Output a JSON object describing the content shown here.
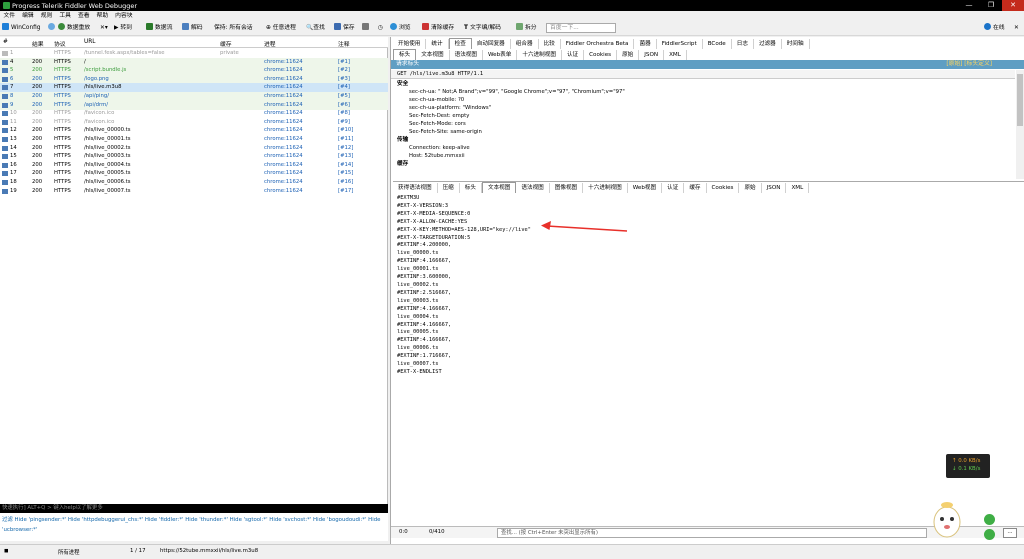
{
  "window": {
    "title": "Progress Telerik Fiddler Web Debugger",
    "controls": [
      "—",
      "❐",
      "✕"
    ]
  },
  "menu": [
    "文件",
    "编辑",
    "规则",
    "工具",
    "查看",
    "帮助",
    "内容块"
  ],
  "toolbar": [
    {
      "label": "WinConfig",
      "icon": "windows-icon"
    },
    {
      "label": "",
      "icon": "comment-icon"
    },
    {
      "label": "数据重放",
      "icon": "replay-icon"
    },
    {
      "label": "",
      "icon": "remove-icon"
    },
    {
      "label": "转到",
      "icon": "play-icon"
    },
    {
      "label": "数据流",
      "icon": "stream-icon"
    },
    {
      "label": "解码",
      "icon": "decode-icon"
    },
    {
      "label": "保持: 所有会话",
      "icon": ""
    },
    {
      "label": "任意进程",
      "icon": "crosshair-icon"
    },
    {
      "label": "查找",
      "icon": "find-icon"
    },
    {
      "label": "保存",
      "icon": "save-icon"
    },
    {
      "label": "",
      "icon": "camera-icon"
    },
    {
      "label": "",
      "icon": "clock-icon"
    },
    {
      "label": "浏览",
      "icon": "browse-icon"
    },
    {
      "label": "清除缓存",
      "icon": "clear-cache-icon"
    },
    {
      "label": "文字编/解码",
      "icon": "text-wizard-icon"
    },
    {
      "label": "拆分",
      "icon": "tearoff-icon"
    }
  ],
  "toolbar_search": "百度一下...",
  "online_label": "在线",
  "sessions": {
    "columns": [
      "#",
      "结果",
      "协议",
      "URL",
      "缓存",
      "进程",
      "注释"
    ],
    "rows": [
      {
        "id": "1",
        "result": "",
        "protocol": "HTTPS",
        "url": "/tunnel.fesk.aspx/tables=false",
        "cache": "private",
        "process": "",
        "comment": ""
      },
      {
        "id": "4",
        "result": "200",
        "protocol": "HTTPS",
        "url": "/",
        "cache": "",
        "process": "chrome:11624",
        "comment": "[#1]"
      },
      {
        "id": "5",
        "result": "200",
        "protocol": "HTTPS",
        "url": "/script.bundle.js",
        "cache": "",
        "process": "chrome:11624",
        "comment": "[#2]"
      },
      {
        "id": "6",
        "result": "200",
        "protocol": "HTTPS",
        "url": "/logo.png",
        "cache": "",
        "process": "chrome:11624",
        "comment": "[#3]"
      },
      {
        "id": "7",
        "result": "200",
        "protocol": "HTTPS",
        "url": "/hls/live.m3u8",
        "cache": "",
        "process": "chrome:11624",
        "comment": "[#4]"
      },
      {
        "id": "8",
        "result": "200",
        "protocol": "HTTPS",
        "url": "/api/ping/",
        "cache": "",
        "process": "chrome:11624",
        "comment": "[#5]"
      },
      {
        "id": "9",
        "result": "200",
        "protocol": "HTTPS",
        "url": "/api/drm/",
        "cache": "",
        "process": "chrome:11624",
        "comment": "[#6]"
      },
      {
        "id": "10",
        "result": "200",
        "protocol": "HTTPS",
        "url": "/favicon.ico",
        "cache": "",
        "process": "chrome:11624",
        "comment": "[#8]"
      },
      {
        "id": "11",
        "result": "200",
        "protocol": "HTTPS",
        "url": "/favicon.ico",
        "cache": "",
        "process": "chrome:11624",
        "comment": "[#9]"
      },
      {
        "id": "12",
        "result": "200",
        "protocol": "HTTPS",
        "url": "/hls/live_00000.ts",
        "cache": "",
        "process": "chrome:11624",
        "comment": "[#10]"
      },
      {
        "id": "13",
        "result": "200",
        "protocol": "HTTPS",
        "url": "/hls/live_00001.ts",
        "cache": "",
        "process": "chrome:11624",
        "comment": "[#11]"
      },
      {
        "id": "14",
        "result": "200",
        "protocol": "HTTPS",
        "url": "/hls/live_00002.ts",
        "cache": "",
        "process": "chrome:11624",
        "comment": "[#12]"
      },
      {
        "id": "15",
        "result": "200",
        "protocol": "HTTPS",
        "url": "/hls/live_00003.ts",
        "cache": "",
        "process": "chrome:11624",
        "comment": "[#13]"
      },
      {
        "id": "16",
        "result": "200",
        "protocol": "HTTPS",
        "url": "/hls/live_00004.ts",
        "cache": "",
        "process": "chrome:11624",
        "comment": "[#14]"
      },
      {
        "id": "17",
        "result": "200",
        "protocol": "HTTPS",
        "url": "/hls/live_00005.ts",
        "cache": "",
        "process": "chrome:11624",
        "comment": "[#15]"
      },
      {
        "id": "18",
        "result": "200",
        "protocol": "HTTPS",
        "url": "/hls/live_00006.ts",
        "cache": "",
        "process": "chrome:11624",
        "comment": "[#16]"
      },
      {
        "id": "19",
        "result": "200",
        "protocol": "HTTPS",
        "url": "/hls/live_00007.ts",
        "cache": "",
        "process": "chrome:11624",
        "comment": "[#17]"
      }
    ]
  },
  "quickexec_placeholder": "快速执行] ALT+Q > 键入help以了解更多",
  "filters": "过滤  Hide 'pingsender:*'  Hide 'httpdebuggerui_chs:*'  Hide 'fiddler:*'  Hide 'thunder:*'  Hide 'sgtool:*'  Hide 'svchost:*'  Hide 'bogoudoudi:*'  Hide 'ucbrowser:*'",
  "status": {
    "process": "所有进程",
    "count": "1 / 17",
    "url": "https://52tube.mmxxii/hls/live.m3u8"
  },
  "inspector_tabs_top": [
    "开始使用",
    "统计",
    "检查",
    "自动回复器",
    "组合器",
    "比较",
    "Fiddler Orchestra Beta",
    "菌器",
    "FiddlerScript",
    "BCode",
    "日志",
    "过滤器",
    "时间轴"
  ],
  "request_tabs": [
    "标头",
    "文本视图",
    "语法视图",
    "Web表单",
    "十六进制视图",
    "认证",
    "Cookies",
    "原始",
    "JSON",
    "XML"
  ],
  "request_header_title": "请求标头",
  "request_header_right": "[原始]  [标头定义]",
  "request_line": "GET /hls/live.m3u8 HTTP/1.1",
  "headers": [
    {
      "group": "安全",
      "items": [
        "sec-ch-ua: \" Not;A Brand\";v=\"99\", \"Google Chrome\";v=\"97\", \"Chromium\";v=\"97\"",
        "sec-ch-ua-mobile: ?0",
        "sec-ch-ua-platform: \"Windows\"",
        "Sec-Fetch-Dest: empty",
        "Sec-Fetch-Mode: cors",
        "Sec-Fetch-Site: same-origin"
      ]
    },
    {
      "group": "传输",
      "items": [
        "Connection: keep-alive",
        "Host: 52tube.mmxxii"
      ]
    },
    {
      "group": "缓存",
      "items": []
    }
  ],
  "response_tabs": [
    "获得语法视图",
    "压缩",
    "标头",
    "文本视图",
    "语法视图",
    "图像视图",
    "十六进制视图",
    "Web视图",
    "认证",
    "缓存",
    "Cookies",
    "原始",
    "JSON",
    "XML"
  ],
  "response_lines": [
    "#EXTM3U",
    "#EXT-X-VERSION:3",
    "#EXT-X-MEDIA-SEQUENCE:0",
    "#EXT-X-ALLOW-CACHE:YES",
    "#EXT-X-KEY:METHOD=AES-128,URI=\"key://live\"",
    "#EXT-X-TARGETDURATION:5",
    "#EXTINF:4.200000,",
    "live_00000.ts",
    "#EXTINF:4.166667,",
    "live_00001.ts",
    "#EXTINF:3.600000,",
    "live_00002.ts",
    "#EXTINF:2.516667,",
    "live_00003.ts",
    "#EXTINF:4.166667,",
    "live_00004.ts",
    "#EXTINF:4.166667,",
    "live_00005.ts",
    "#EXTINF:4.166667,",
    "live_00006.ts",
    "#EXTINF:1.716667,",
    "live_00007.ts",
    "#EXT-X-ENDLIST"
  ],
  "bottom": {
    "pos": "0:0",
    "count": "0/410",
    "find_placeholder": "查找... (按 Ctrl+Enter 未突出显示所有)"
  },
  "speed": {
    "up": "↑ 0.0 KB/s",
    "down": "↓ 0.1 KB/s"
  },
  "colors": {
    "accent": "#5f9ec3",
    "arrow": "#e8302a",
    "js": "#3a9b3a",
    "selected": "#cfe5f7"
  }
}
